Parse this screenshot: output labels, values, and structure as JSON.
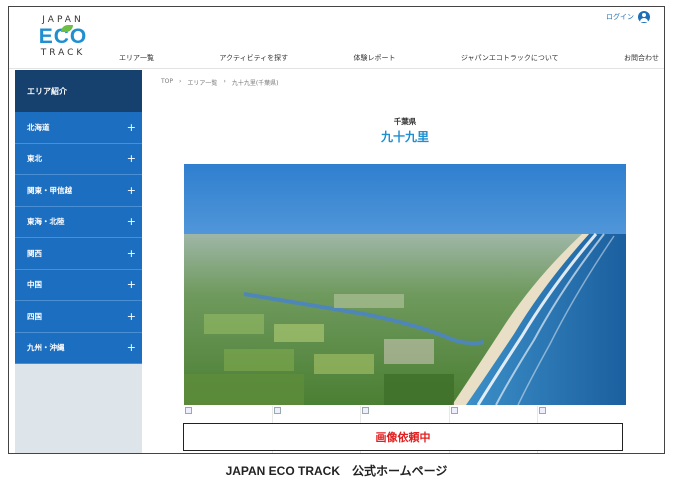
{
  "header": {
    "logo_line1": "JAPAN",
    "logo_line2": "ECO",
    "logo_line3": "TRACK",
    "login": "ログイン",
    "nav": [
      "エリア一覧",
      "アクティビティを探す",
      "体験レポート",
      "ジャパンエコトラックについて",
      "お問合わせ"
    ]
  },
  "sidebar": {
    "heading": "エリア紹介",
    "items": [
      "北海道",
      "東北",
      "関東・甲信越",
      "東海・北陸",
      "関西",
      "中国",
      "四国",
      "九州・沖縄"
    ],
    "expand_glyph": "+"
  },
  "breadcrumb": [
    "TOP",
    "エリア一覧",
    "九十九里(千葉県)"
  ],
  "breadcrumb_sep": "›",
  "main": {
    "prefecture": "千葉県",
    "title": "九十九里",
    "notice": "画像依頼中"
  },
  "caption": "JAPAN ECO TRACK　公式ホームページ",
  "colors": {
    "accent": "#1e8fd0",
    "sidebar_item": "#1c6fc0",
    "sidebar_head": "#16416e",
    "notice": "#e02020"
  }
}
